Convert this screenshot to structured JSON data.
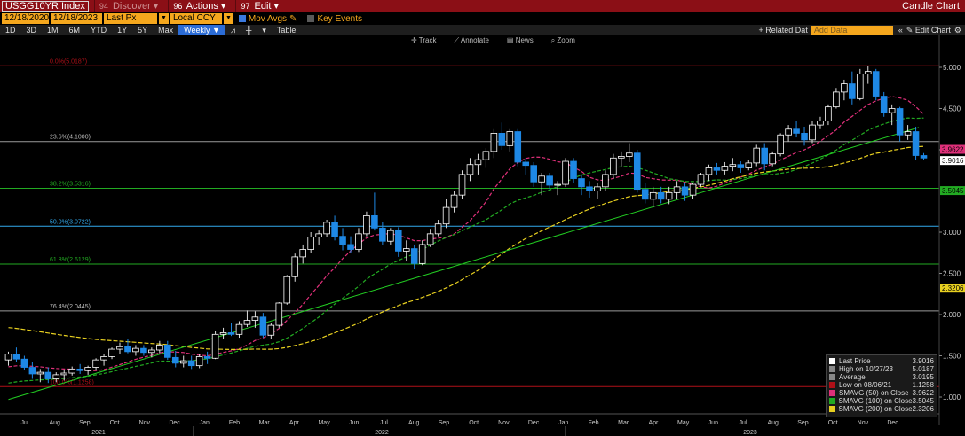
{
  "topbar": {
    "ticker": "USGG10YR Index",
    "menus": [
      {
        "num": "94",
        "label": "Discover"
      },
      {
        "num": "96",
        "label": "Actions"
      },
      {
        "num": "97",
        "label": "Edit"
      }
    ],
    "title": "Candle Chart"
  },
  "toolbar": {
    "start_date": "12/18/2020",
    "end_date": "12/18/2023",
    "price_field": "Last Px",
    "currency": "Local CCY",
    "mov_avgs_label": "Mov Avgs",
    "key_events_label": "Key Events"
  },
  "ranges": [
    "1D",
    "3D",
    "1M",
    "6M",
    "YTD",
    "1Y",
    "5Y",
    "Max"
  ],
  "period": "Weekly",
  "table_label": "Table",
  "related_label": "+ Related Dat",
  "add_data_placeholder": "Add Data",
  "edit_chart_label": "Edit Chart",
  "tools": [
    "Track",
    "Annotate",
    "News",
    "Zoom"
  ],
  "colors": {
    "up": "#ffffff",
    "down": "#1e88e5",
    "sma50": "#e0307a",
    "sma100": "#22aa22",
    "sma200": "#e8d020",
    "trend": "#22cc22",
    "fib_high": "#b01018",
    "fib_mid": "#9a9a9a",
    "fib_382": "#22aa22",
    "fib_50": "#33aaee",
    "fib_618": "#22aa22",
    "fib_764": "#9a9a9a",
    "fib_low": "#b01018"
  },
  "chart_data": {
    "type": "candlestick",
    "y_axis_side": "right",
    "ylim": [
      0.9,
      5.15
    ],
    "y_ticks": [
      "1.000",
      "1.500",
      "2.000",
      "2.500",
      "3.000",
      "3.500",
      "4.000",
      "4.500",
      "5.000"
    ],
    "x_months": [
      "Jul",
      "Aug",
      "Sep",
      "Oct",
      "Nov",
      "Dec",
      "Jan",
      "Feb",
      "Mar",
      "Apr",
      "May",
      "Jun",
      "Jul",
      "Aug",
      "Sep",
      "Oct",
      "Nov",
      "Dec",
      "Jan",
      "Feb",
      "Mar",
      "Apr",
      "May",
      "Jun",
      "Jul",
      "Aug",
      "Sep",
      "Oct",
      "Nov",
      "Dec"
    ],
    "x_years": [
      "2021",
      "2022",
      "2023"
    ],
    "fib_levels": [
      {
        "label": "0.0%(5.0187)",
        "value": 5.0187,
        "color_key": "fib_high"
      },
      {
        "label": "23.6%(4.1000)",
        "value": 4.1,
        "color_key": "fib_mid"
      },
      {
        "label": "38.2%(3.5316)",
        "value": 3.5316,
        "color_key": "fib_382"
      },
      {
        "label": "50.0%(3.0722)",
        "value": 3.0722,
        "color_key": "fib_50"
      },
      {
        "label": "61.8%(2.6129)",
        "value": 2.6129,
        "color_key": "fib_618"
      },
      {
        "label": "76.4%(2.0445)",
        "value": 2.0445,
        "color_key": "fib_764"
      },
      {
        "label": "100.0%(1.1258)",
        "value": 1.1258,
        "color_key": "fib_low"
      }
    ],
    "last_value_labels": [
      {
        "text": "3.9622",
        "value": 3.9622,
        "bg": "#e0307a"
      },
      {
        "text": "3.9016",
        "value": 3.9016,
        "bg": "#ffffff"
      },
      {
        "text": "3.5045",
        "value": 3.5045,
        "bg": "#22aa22"
      },
      {
        "text": "2.3206",
        "value": 2.3206,
        "bg": "#e8d020"
      }
    ],
    "candles": [
      [
        1.45,
        1.55,
        1.38,
        1.52
      ],
      [
        1.52,
        1.6,
        1.42,
        1.46
      ],
      [
        1.46,
        1.5,
        1.33,
        1.36
      ],
      [
        1.36,
        1.42,
        1.22,
        1.28
      ],
      [
        1.28,
        1.34,
        1.18,
        1.3
      ],
      [
        1.3,
        1.36,
        1.17,
        1.22
      ],
      [
        1.22,
        1.3,
        1.18,
        1.27
      ],
      [
        1.27,
        1.33,
        1.2,
        1.29
      ],
      [
        1.29,
        1.37,
        1.26,
        1.34
      ],
      [
        1.34,
        1.4,
        1.28,
        1.32
      ],
      [
        1.32,
        1.38,
        1.27,
        1.36
      ],
      [
        1.36,
        1.47,
        1.33,
        1.45
      ],
      [
        1.45,
        1.52,
        1.38,
        1.49
      ],
      [
        1.49,
        1.6,
        1.46,
        1.58
      ],
      [
        1.58,
        1.66,
        1.52,
        1.61
      ],
      [
        1.61,
        1.7,
        1.53,
        1.55
      ],
      [
        1.55,
        1.63,
        1.5,
        1.59
      ],
      [
        1.59,
        1.63,
        1.5,
        1.54
      ],
      [
        1.54,
        1.6,
        1.48,
        1.57
      ],
      [
        1.57,
        1.68,
        1.53,
        1.63
      ],
      [
        1.63,
        1.68,
        1.45,
        1.48
      ],
      [
        1.48,
        1.56,
        1.36,
        1.41
      ],
      [
        1.41,
        1.5,
        1.36,
        1.44
      ],
      [
        1.44,
        1.5,
        1.34,
        1.38
      ],
      [
        1.38,
        1.52,
        1.35,
        1.49
      ],
      [
        1.49,
        1.55,
        1.4,
        1.47
      ],
      [
        1.47,
        1.8,
        1.46,
        1.76
      ],
      [
        1.76,
        1.84,
        1.7,
        1.78
      ],
      [
        1.78,
        1.9,
        1.74,
        1.76
      ],
      [
        1.76,
        1.92,
        1.72,
        1.88
      ],
      [
        1.88,
        2.05,
        1.85,
        1.93
      ],
      [
        1.93,
        2.04,
        1.84,
        1.97
      ],
      [
        1.97,
        2.02,
        1.72,
        1.75
      ],
      [
        1.75,
        1.9,
        1.7,
        1.87
      ],
      [
        1.87,
        2.15,
        1.84,
        2.14
      ],
      [
        2.14,
        2.48,
        2.12,
        2.46
      ],
      [
        2.46,
        2.74,
        2.4,
        2.7
      ],
      [
        2.7,
        2.85,
        2.62,
        2.79
      ],
      [
        2.79,
        3.0,
        2.75,
        2.94
      ],
      [
        2.94,
        3.02,
        2.85,
        2.98
      ],
      [
        2.98,
        3.15,
        2.94,
        3.12
      ],
      [
        3.12,
        3.2,
        2.9,
        2.95
      ],
      [
        2.95,
        3.05,
        2.78,
        2.85
      ],
      [
        2.85,
        2.95,
        2.75,
        2.79
      ],
      [
        2.79,
        3.05,
        2.76,
        2.98
      ],
      [
        2.98,
        3.25,
        2.95,
        3.2
      ],
      [
        3.2,
        3.48,
        3.02,
        3.05
      ],
      [
        3.05,
        3.12,
        2.85,
        2.89
      ],
      [
        2.89,
        3.05,
        2.85,
        3.02
      ],
      [
        3.02,
        3.06,
        2.7,
        2.77
      ],
      [
        2.77,
        2.9,
        2.65,
        2.8
      ],
      [
        2.8,
        2.85,
        2.55,
        2.62
      ],
      [
        2.62,
        2.9,
        2.6,
        2.85
      ],
      [
        2.85,
        3.04,
        2.82,
        2.98
      ],
      [
        2.98,
        3.15,
        2.95,
        3.1
      ],
      [
        3.1,
        3.4,
        3.05,
        3.3
      ],
      [
        3.3,
        3.5,
        3.24,
        3.45
      ],
      [
        3.45,
        3.75,
        3.4,
        3.7
      ],
      [
        3.7,
        3.9,
        3.62,
        3.82
      ],
      [
        3.82,
        3.95,
        3.7,
        3.88
      ],
      [
        3.88,
        4.02,
        3.78,
        3.98
      ],
      [
        3.98,
        4.25,
        3.9,
        4.2
      ],
      [
        4.2,
        4.33,
        4.0,
        4.05
      ],
      [
        4.05,
        4.25,
        3.98,
        4.22
      ],
      [
        4.22,
        4.25,
        3.8,
        3.85
      ],
      [
        3.85,
        3.9,
        3.7,
        3.81
      ],
      [
        3.81,
        3.85,
        3.55,
        3.61
      ],
      [
        3.61,
        3.72,
        3.45,
        3.68
      ],
      [
        3.68,
        3.72,
        3.52,
        3.57
      ],
      [
        3.57,
        3.62,
        3.45,
        3.58
      ],
      [
        3.58,
        3.9,
        3.55,
        3.86
      ],
      [
        3.86,
        3.9,
        3.6,
        3.65
      ],
      [
        3.65,
        3.7,
        3.45,
        3.55
      ],
      [
        3.55,
        3.62,
        3.42,
        3.5
      ],
      [
        3.5,
        3.6,
        3.4,
        3.55
      ],
      [
        3.55,
        3.75,
        3.5,
        3.7
      ],
      [
        3.7,
        3.95,
        3.65,
        3.9
      ],
      [
        3.9,
        3.98,
        3.8,
        3.92
      ],
      [
        3.92,
        4.08,
        3.85,
        3.96
      ],
      [
        3.96,
        4.0,
        3.48,
        3.52
      ],
      [
        3.52,
        3.6,
        3.35,
        3.4
      ],
      [
        3.4,
        3.55,
        3.3,
        3.48
      ],
      [
        3.48,
        3.55,
        3.35,
        3.4
      ],
      [
        3.4,
        3.55,
        3.34,
        3.48
      ],
      [
        3.48,
        3.62,
        3.4,
        3.55
      ],
      [
        3.55,
        3.6,
        3.38,
        3.45
      ],
      [
        3.45,
        3.6,
        3.4,
        3.58
      ],
      [
        3.58,
        3.72,
        3.55,
        3.7
      ],
      [
        3.7,
        3.82,
        3.62,
        3.78
      ],
      [
        3.78,
        3.84,
        3.7,
        3.75
      ],
      [
        3.75,
        3.85,
        3.7,
        3.8
      ],
      [
        3.8,
        3.9,
        3.74,
        3.82
      ],
      [
        3.82,
        3.86,
        3.72,
        3.78
      ],
      [
        3.78,
        3.88,
        3.75,
        3.84
      ],
      [
        3.84,
        4.06,
        3.8,
        4.02
      ],
      [
        4.02,
        4.08,
        3.75,
        3.83
      ],
      [
        3.83,
        3.98,
        3.8,
        3.95
      ],
      [
        3.95,
        4.2,
        3.92,
        4.18
      ],
      [
        4.18,
        4.3,
        4.1,
        4.25
      ],
      [
        4.25,
        4.35,
        4.15,
        4.2
      ],
      [
        4.2,
        4.28,
        4.05,
        4.12
      ],
      [
        4.12,
        4.35,
        4.08,
        4.3
      ],
      [
        4.3,
        4.4,
        4.25,
        4.35
      ],
      [
        4.35,
        4.55,
        4.3,
        4.52
      ],
      [
        4.52,
        4.75,
        4.5,
        4.7
      ],
      [
        4.7,
        4.85,
        4.6,
        4.8
      ],
      [
        4.8,
        4.95,
        4.55,
        4.62
      ],
      [
        4.62,
        4.98,
        4.6,
        4.92
      ],
      [
        4.92,
        5.02,
        4.8,
        4.95
      ],
      [
        4.95,
        4.98,
        4.6,
        4.65
      ],
      [
        4.65,
        4.7,
        4.4,
        4.45
      ],
      [
        4.45,
        4.55,
        4.3,
        4.5
      ],
      [
        4.5,
        4.52,
        4.1,
        4.18
      ],
      [
        4.18,
        4.3,
        4.12,
        4.22
      ],
      [
        4.22,
        4.28,
        3.88,
        3.93
      ],
      [
        3.93,
        3.96,
        3.88,
        3.9
      ]
    ]
  },
  "legend": [
    {
      "swatch": "#ffffff",
      "name": "Last Price",
      "value": "3.9016"
    },
    {
      "swatch": "#cccccc",
      "name": "High on 10/27/23",
      "value": "5.0187"
    },
    {
      "swatch": "#cccccc",
      "name": "Average",
      "value": "3.0195"
    },
    {
      "swatch": "#b01018",
      "name": "Low on 08/06/21",
      "value": "1.1258"
    },
    {
      "swatch": "#e0307a",
      "name": "SMAVG (50)  on Close",
      "value": "3.9622"
    },
    {
      "swatch": "#22aa22",
      "name": "SMAVG (100)  on Close",
      "value": "3.5045"
    },
    {
      "swatch": "#e8d020",
      "name": "SMAVG (200)  on Close",
      "value": "2.3206"
    }
  ]
}
